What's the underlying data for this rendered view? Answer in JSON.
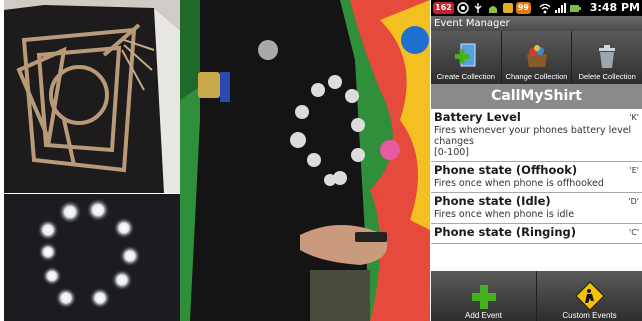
{
  "status_bar": {
    "badge_left": "162",
    "badge_count": "99",
    "time": "3:48 PM"
  },
  "window": {
    "title": "Event Manager"
  },
  "toolbar": {
    "create_collection": "Create Collection",
    "change_collection": "Change Collection",
    "delete_collection": "Delete Collection"
  },
  "app": {
    "title": "CallMyShirt"
  },
  "events": [
    {
      "name": "Battery Level",
      "key": "'K'",
      "desc": "Fires whenever your phones battery level changes",
      "range": "[0-100]"
    },
    {
      "name": "Phone state (Offhook)",
      "key": "'E'",
      "desc": "Fires once when phone is offhooked"
    },
    {
      "name": "Phone state (Idle)",
      "key": "'D'",
      "desc": "Fires once when phone is idle"
    },
    {
      "name": "Phone state (Ringing)",
      "key": "'C'",
      "desc": ""
    }
  ],
  "bottom_bar": {
    "add_event": "Add Event",
    "custom_events": "Custom Events"
  },
  "colors": {
    "badge_red": "#c8202a",
    "badge_orange": "#e07a10",
    "add_green": "#46b020",
    "warning_yellow": "#f2c300"
  }
}
